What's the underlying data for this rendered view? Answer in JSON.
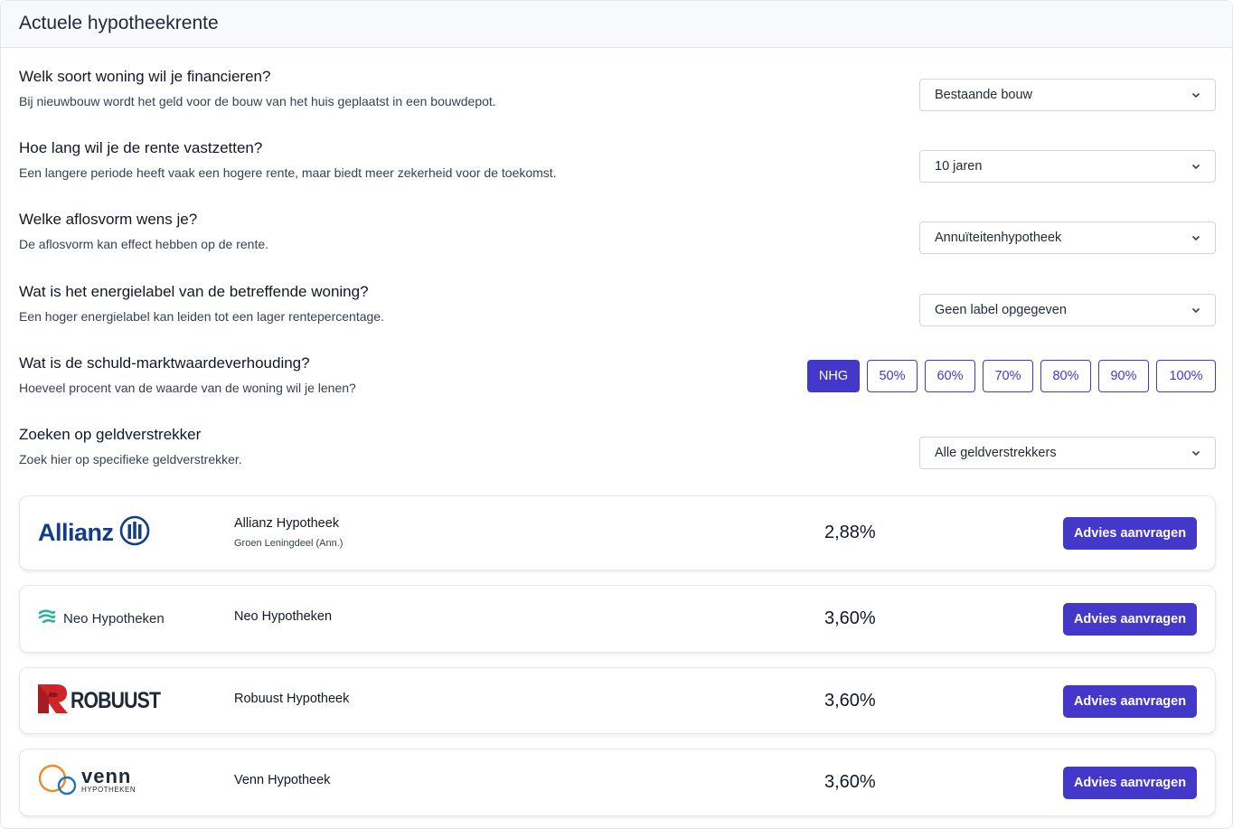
{
  "header": {
    "title": "Actuele hypotheekrente"
  },
  "questions": [
    {
      "title": "Welk soort woning wil je financieren?",
      "subtitle": "Bij nieuwbouw wordt het geld voor de bouw van het huis geplaatst in een bouwdepot.",
      "selected": "Bestaande bouw"
    },
    {
      "title": "Hoe lang wil je de rente vastzetten?",
      "subtitle": "Een langere periode heeft vaak een hogere rente, maar biedt meer zekerheid voor de toekomst.",
      "selected": "10 jaren"
    },
    {
      "title": "Welke aflosvorm wens je?",
      "subtitle": "De aflosvorm kan effect hebben op de rente.",
      "selected": "Annuïteitenhypotheek"
    },
    {
      "title": "Wat is het energielabel van de betreffende woning?",
      "subtitle": "Een hoger energielabel kan leiden tot een lager rentepercentage.",
      "selected": "Geen label opgegeven"
    },
    {
      "title": "Wat is de schuld-marktwaardeverhouding?",
      "subtitle": "Hoeveel procent van de waarde van de woning wil je lenen?",
      "options": [
        "NHG",
        "50%",
        "60%",
        "70%",
        "80%",
        "90%",
        "100%"
      ],
      "active": "NHG"
    },
    {
      "title": "Zoeken op geldverstrekker",
      "subtitle": "Zoek hier op specifieke geldverstrekker.",
      "selected": "Alle geldverstrekkers"
    }
  ],
  "lenders": [
    {
      "logo_text": "Allianz",
      "logo_icon": "allianz-logo-icon",
      "product": "Allianz Hypotheek",
      "product_sub": "Groen Leningdeel (Ann.)",
      "rate": "2,88%",
      "cta": "Advies aanvragen"
    },
    {
      "logo_text": "Neo Hypotheken",
      "logo_icon": "neo-logo-icon",
      "product": "Neo Hypotheken",
      "rate": "3,60%",
      "cta": "Advies aanvragen"
    },
    {
      "logo_text": "ROBUUST",
      "logo_icon": "robuust-logo-icon",
      "product": "Robuust Hypotheek",
      "rate": "3,60%",
      "cta": "Advies aanvragen"
    },
    {
      "logo_text": "venn",
      "logo_subtext": "HYPOTHEKEN",
      "logo_icon": "venn-logo-icon",
      "product": "Venn Hypotheek",
      "rate": "3,60%",
      "cta": "Advies aanvragen"
    }
  ],
  "colors": {
    "primary": "#4338ca",
    "allianz": "#123c8c",
    "neo": "#2bb39b",
    "robuust": "#d3232a",
    "venn_orange": "#f08a24",
    "venn_blue": "#1e73be"
  }
}
